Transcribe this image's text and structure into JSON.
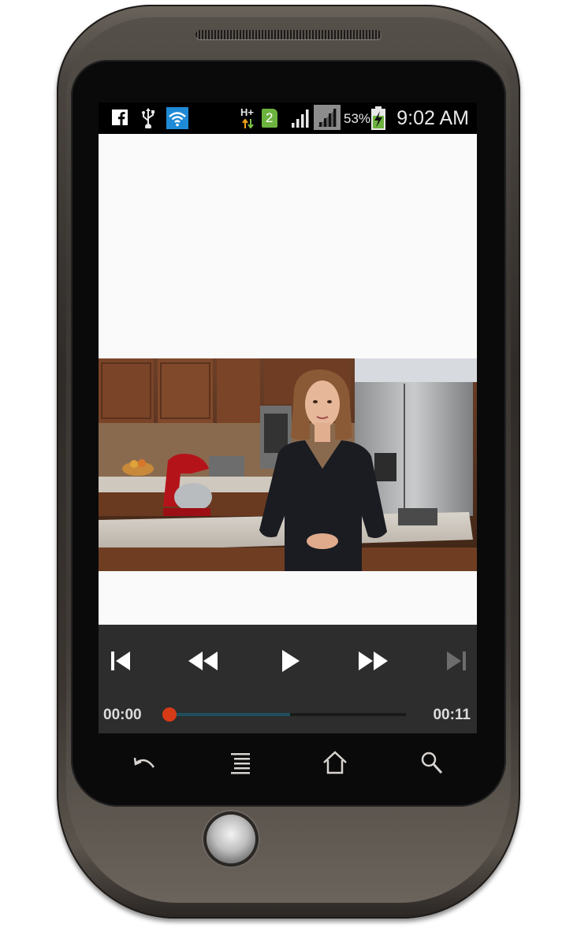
{
  "status_bar": {
    "icons": [
      "facebook-icon",
      "usb-icon",
      "wifi-icon",
      "hspa-data-icon",
      "sim-2-icon",
      "signal-icon",
      "signal-alt-icon",
      "battery-charging-icon"
    ],
    "sim_slot": "2",
    "network_type": "H+",
    "battery_percent": "53%",
    "time": "9:02 AM"
  },
  "player": {
    "controls": [
      "previous-icon",
      "rewind-icon",
      "play-icon",
      "fast-forward-icon",
      "next-icon"
    ],
    "current_time": "00:00",
    "total_time": "00:11",
    "progress": 0.0,
    "buffered": 0.51,
    "accent_color": "#d63a16",
    "buffer_color": "#20505e"
  },
  "navigation": {
    "icons": [
      "back-icon",
      "menu-icon",
      "home-icon",
      "search-icon"
    ]
  }
}
